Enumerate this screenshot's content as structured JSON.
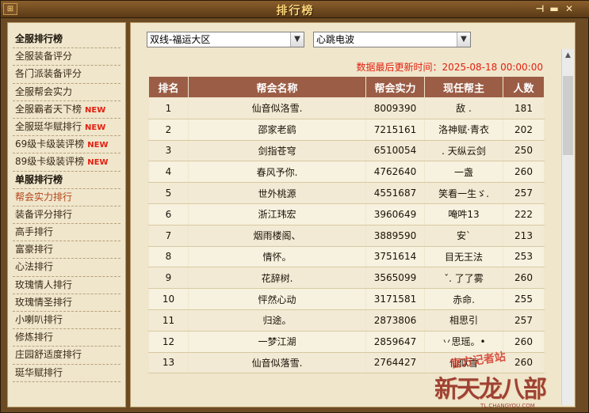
{
  "window": {
    "title": "排行榜",
    "left_icon": "⊞",
    "pin_icon": "pin-icon",
    "min_icon": "minimize-icon",
    "close_icon": "close-icon"
  },
  "sidebar": {
    "items": [
      {
        "label": "全服排行榜",
        "type": "section"
      },
      {
        "label": "全服装备评分",
        "type": "item"
      },
      {
        "label": "各门派装备评分",
        "type": "item"
      },
      {
        "label": "全服帮会实力",
        "type": "item"
      },
      {
        "label": "全服霸者天下榜",
        "type": "item",
        "badge": "NEW"
      },
      {
        "label": "全服珽华赋排行",
        "type": "item",
        "badge": "NEW"
      },
      {
        "label": "69级卡级装评榜",
        "type": "item",
        "badge": "NEW"
      },
      {
        "label": "89级卡级装评榜",
        "type": "item",
        "badge": "NEW"
      },
      {
        "label": "单服排行榜",
        "type": "section"
      },
      {
        "label": "帮会实力排行",
        "type": "item",
        "active": true
      },
      {
        "label": "装备评分排行",
        "type": "item"
      },
      {
        "label": "高手排行",
        "type": "item"
      },
      {
        "label": "富豪排行",
        "type": "item"
      },
      {
        "label": "心法排行",
        "type": "item"
      },
      {
        "label": "玫瑰情人排行",
        "type": "item"
      },
      {
        "label": "玫瑰情圣排行",
        "type": "item"
      },
      {
        "label": "小喇叭排行",
        "type": "item"
      },
      {
        "label": "修炼排行",
        "type": "item"
      },
      {
        "label": "庄园舒适度排行",
        "type": "item"
      },
      {
        "label": "珽华赋排行",
        "type": "item"
      }
    ]
  },
  "filters": {
    "region": "双线-福运大区",
    "server": "心跳电波"
  },
  "update": {
    "label": "数据最后更新时间：",
    "time": "2025-08-18 00:00:00"
  },
  "table": {
    "headers": [
      "排名",
      "帮会名称",
      "帮会实力",
      "现任帮主",
      "人数"
    ],
    "rows": [
      [
        "1",
        "仙音似洛雪.",
        "8009390",
        "敌 .",
        "181"
      ],
      [
        "2",
        "邵家老鹞",
        "7215161",
        "洛神赋·青衣",
        "202"
      ],
      [
        "3",
        "剑指苍穹",
        "6510054",
        ". 天纵云剑",
        "250"
      ],
      [
        "4",
        "春风予你.",
        "4762640",
        "一盏",
        "260"
      ],
      [
        "5",
        "世外桃源",
        "4551687",
        "笑看一生ゞ.",
        "257"
      ],
      [
        "6",
        "浙江玮宏",
        "3960649",
        "唵吽13",
        "222"
      ],
      [
        "7",
        "烟雨楼阁、",
        "3889590",
        "安`",
        "213"
      ],
      [
        "8",
        "情怀。",
        "3751614",
        "目无王法",
        "253"
      ],
      [
        "9",
        "花辞树.",
        "3565099",
        "ˇ. 了了雾",
        "260"
      ],
      [
        "10",
        "怦然心动",
        "3171581",
        "赤命.",
        "255"
      ],
      [
        "11",
        "归途。",
        "2873806",
        "相思引",
        "257"
      ],
      [
        "12",
        "一梦江湖",
        "2859647",
        "丷思瑶。•",
        "260"
      ],
      [
        "13",
        "仙音似落雪.",
        "2764427",
        "仙似雪",
        "260"
      ]
    ]
  },
  "watermark": {
    "official": "官方记者站",
    "logo": "新天龙八部",
    "url": "TL.CHANGYOU.COM"
  }
}
